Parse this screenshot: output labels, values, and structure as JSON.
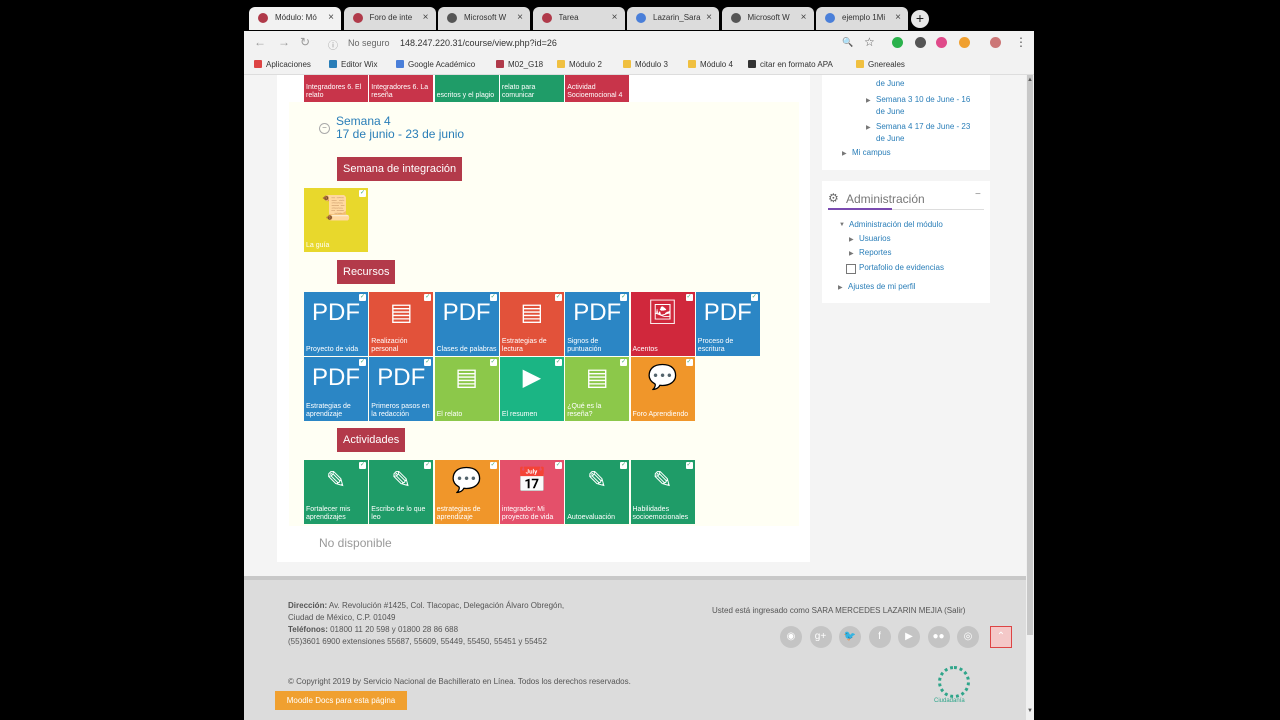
{
  "browser": {
    "tabs": [
      {
        "label": "Módulo: Mó",
        "active": true,
        "color": "#b03a4a"
      },
      {
        "label": "Foro de inte",
        "active": false,
        "color": "#b03a4a"
      },
      {
        "label": "Microsoft W",
        "active": false,
        "color": "#555555"
      },
      {
        "label": "Tarea",
        "active": false,
        "color": "#b03a4a"
      },
      {
        "label": "Lazarin_Sara",
        "active": false,
        "color": "#4a7fd9"
      },
      {
        "label": "Microsoft W",
        "active": false,
        "color": "#555555"
      },
      {
        "label": "ejemplo 1Mi",
        "active": false,
        "color": "#4a7fd9"
      }
    ],
    "close_glyph": "×",
    "new_tab_glyph": "+",
    "back_glyph": "←",
    "forward_glyph": "→",
    "reload_glyph": "↻",
    "info_glyph": "ⓘ",
    "secure_label": "No seguro",
    "url": "148.247.220.31/course/view.php?id=26",
    "zoom_glyph": "🔍",
    "star_glyph": "☆",
    "menu_glyph": "⋮",
    "bookmarks": [
      {
        "label": "Aplicaciones",
        "color": "#d44"
      },
      {
        "label": "Editor Wix",
        "color": "#2a7eb8"
      },
      {
        "label": "Google Académico",
        "color": "#4a7fd9"
      },
      {
        "label": "M02_G18",
        "color": "#b03a4a"
      },
      {
        "label": "Módulo 2",
        "color": "#f0c040"
      },
      {
        "label": "Módulo 3",
        "color": "#f0c040"
      },
      {
        "label": "Módulo 4",
        "color": "#f0c040"
      },
      {
        "label": "citar en formato APA",
        "color": "#333333"
      },
      {
        "label": "Gnereales",
        "color": "#f0c040"
      }
    ]
  },
  "top_tiles": [
    {
      "label": "Integradores 6. El relato",
      "color": "#c8344a"
    },
    {
      "label": "Integradores 6. La reseña",
      "color": "#c8344a"
    },
    {
      "label": "escritos y el plagio",
      "color": "#1f9c68"
    },
    {
      "label": "relato para comunicar",
      "color": "#1f9c68"
    },
    {
      "label": "Actividad Socioemocional 4",
      "color": "#c8344a"
    }
  ],
  "week": {
    "collapse_glyph": "−",
    "title": "Semana 4",
    "dates": "17 de junio - 23 de junio",
    "integration_header": "Semana de integración",
    "guide_tile": {
      "label": "La guía",
      "color": "#e8d82c",
      "icon": "📜"
    },
    "resources_header": "Recursos",
    "resources": [
      {
        "label": "Proyecto de vida",
        "color": "#2b86c5",
        "icon": "PDF"
      },
      {
        "label": "Realización personal",
        "color": "#e2523a",
        "icon": "▤"
      },
      {
        "label": "Clases de palabras",
        "color": "#2b86c5",
        "icon": "PDF"
      },
      {
        "label": "Estrategias de lectura",
        "color": "#e2523a",
        "icon": "▤"
      },
      {
        "label": "Signos de puntuación",
        "color": "#2b86c5",
        "icon": "PDF"
      },
      {
        "label": "Acentos",
        "color": "#d0283c",
        "icon": "🖼"
      },
      {
        "label": "Proceso de escritura",
        "color": "#2b86c5",
        "icon": "PDF"
      },
      {
        "label": "Estrategias de aprendizaje",
        "color": "#2b86c5",
        "icon": "PDF"
      },
      {
        "label": "Primeros pasos en la redacción",
        "color": "#2b86c5",
        "icon": "PDF"
      },
      {
        "label": "El relato",
        "color": "#8cc84a",
        "icon": "▤"
      },
      {
        "label": "El resumen",
        "color": "#1bb584",
        "icon": "▶"
      },
      {
        "label": "¿Qué es la reseña?",
        "color": "#8cc84a",
        "icon": "▤"
      },
      {
        "label": "Foro Aprendiendo",
        "color": "#f0962a",
        "icon": "💬"
      }
    ],
    "activities_header": "Actividades",
    "activities": [
      {
        "label": "Fortalecer mis aprendizajes",
        "color": "#1f9c68",
        "icon": "✎"
      },
      {
        "label": "Escribo de lo que leo",
        "color": "#1f9c68",
        "icon": "✎"
      },
      {
        "label": "estrategias de aprendizaje",
        "color": "#f0962a",
        "icon": "💬"
      },
      {
        "label": "integrador: Mi proyecto de vida",
        "color": "#e4506a",
        "icon": "📅"
      },
      {
        "label": "Autoevaluación",
        "color": "#1f9c68",
        "icon": "✎"
      },
      {
        "label": "Habilidades socioemocionales",
        "color": "#1f9c68",
        "icon": "✎"
      }
    ],
    "check_glyph": "✓"
  },
  "not_available": "No disponible",
  "sidebar": {
    "nav_items": [
      {
        "label": "de June"
      },
      {
        "label": "Semana 3 10 de June - 16 de June"
      },
      {
        "label": "Semana 4 17 de June - 23 de June"
      },
      {
        "label": "Mi campus"
      }
    ],
    "tri_right_glyph": "▶",
    "tri_down_glyph": "▼",
    "admin_title": "Administración",
    "admin_icon_glyph": "⚙",
    "admin_collapse_glyph": "−",
    "admin_items": [
      {
        "label": "Administración del módulo"
      },
      {
        "label": "Usuarios"
      },
      {
        "label": "Reportes"
      },
      {
        "label": "Portafolio de evidencias"
      },
      {
        "label": "Ajustes de mi perfil"
      }
    ]
  },
  "footer": {
    "address_label": "Dirección:",
    "address_line1": "Av. Revolución #1425, Col. Tlacopac, Delegación Álvaro Obregón,",
    "address_line2": "Ciudad de México, C.P. 01049",
    "phones_label": "Teléfonos:",
    "phones_line1": "01800 11 20 598 y 01800 28 86 688",
    "phones_line2": "(55)3601 6900 extensiones 55687, 55609, 55449, 55450, 55451 y 55452",
    "login_text": "Usted está ingresado como SARA MERCEDES LAZARIN MEJIA (Salir)",
    "social_icons": [
      "◉",
      "g+",
      "🐦",
      "f",
      "▶",
      "●●",
      "◎"
    ],
    "top_glyph": "⌃",
    "copyright": "© Copyright 2019 by Servicio Nacional de Bachillerato en Línea. Todos los derechos reservados.",
    "moodle_docs": "Moodle Docs para esta página",
    "logo_text": "Ciudadanía",
    "scroll_up_glyph": "▲",
    "scroll_down_glyph": "▼"
  }
}
